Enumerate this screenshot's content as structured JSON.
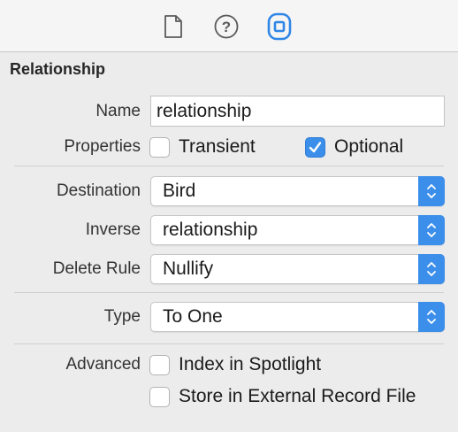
{
  "toolbar": {
    "tabs": [
      {
        "icon": "file-icon",
        "active": false
      },
      {
        "icon": "help-icon",
        "active": false
      },
      {
        "icon": "data-model-inspector-icon",
        "active": true
      }
    ]
  },
  "section": {
    "title": "Relationship"
  },
  "name": {
    "label": "Name",
    "value": "relationship"
  },
  "properties": {
    "label": "Properties",
    "transient": {
      "label": "Transient",
      "checked": false
    },
    "optional": {
      "label": "Optional",
      "checked": true
    }
  },
  "destination": {
    "label": "Destination",
    "value": "Bird"
  },
  "inverse": {
    "label": "Inverse",
    "value": "relationship"
  },
  "delete_rule": {
    "label": "Delete Rule",
    "value": "Nullify"
  },
  "type": {
    "label": "Type",
    "value": "To One"
  },
  "advanced": {
    "label": "Advanced",
    "index_in_spotlight": {
      "label": "Index in Spotlight",
      "checked": false
    },
    "store_external": {
      "label": "Store in External Record File",
      "checked": false
    }
  },
  "colors": {
    "accent": "#3b8eea",
    "background": "#ececec"
  }
}
